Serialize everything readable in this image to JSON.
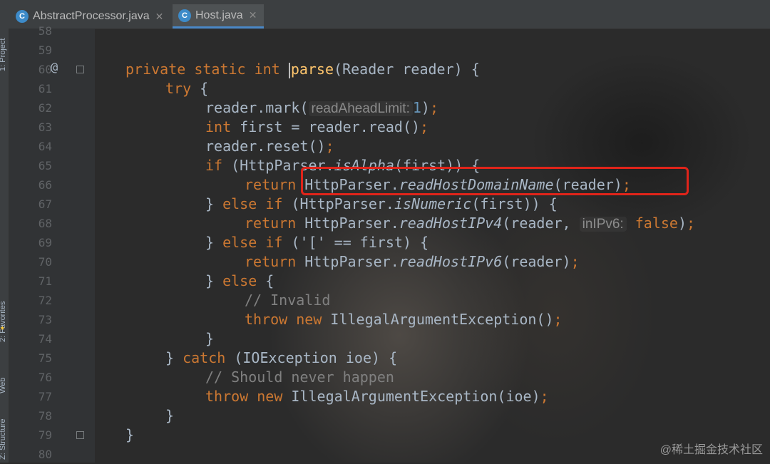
{
  "tabs": [
    {
      "label": "AbstractProcessor.java",
      "icon": "C",
      "active": false
    },
    {
      "label": "Host.java",
      "icon": "C",
      "active": true
    }
  ],
  "toolstrip": {
    "project_label": "1: Project",
    "favorites_label": "2: Favorites",
    "web_label": "Web",
    "structure_label": "Z: Structure"
  },
  "gutter": {
    "annotation_mark": "@",
    "line_numbers": [
      "58",
      "59",
      "60",
      "61",
      "62",
      "63",
      "64",
      "65",
      "66",
      "67",
      "68",
      "69",
      "70",
      "71",
      "72",
      "73",
      "74",
      "75",
      "76",
      "77",
      "78",
      "79",
      "80"
    ]
  },
  "code": {
    "l60_private": "private",
    "l60_static": "static",
    "l60_int": "int",
    "l60_parse": "parse",
    "l60_rest": "(Reader reader) {",
    "l61_try": "try",
    "l61_rest": " {",
    "l62_a": "reader.mark(",
    "l62_hint": "readAheadLimit:",
    "l62_num": "1",
    "l62_b": ")",
    "l62_semi": ";",
    "l63_int": "int",
    "l63_rest": " first = reader.read()",
    "l63_semi": ";",
    "l64_a": "reader.reset()",
    "l64_semi": ";",
    "l65_if": "if",
    "l65_a": " (HttpParser.",
    "l65_it": "isAlpha",
    "l65_b": "(first)) {",
    "l66_return": "return",
    "l66_a": " HttpParser.",
    "l66_it": "readHostDomainName",
    "l66_b": "(reader)",
    "l66_semi": ";",
    "l67_a": "} ",
    "l67_else": "else",
    "l67_if": "if",
    "l67_b": " (HttpParser.",
    "l67_it": "isNumeric",
    "l67_c": "(first)) {",
    "l68_return": "return",
    "l68_a": " HttpParser.",
    "l68_it": "readHostIPv4",
    "l68_b": "(reader, ",
    "l68_hint": "inIPv6:",
    "l68_false": "false",
    "l68_c": ")",
    "l68_semi": ";",
    "l69_a": "} ",
    "l69_else": "else",
    "l69_if": "if",
    "l69_b": " ('[' == first) {",
    "l70_return": "return",
    "l70_a": " HttpParser.",
    "l70_it": "readHostIPv6",
    "l70_b": "(reader)",
    "l70_semi": ";",
    "l71_a": "} ",
    "l71_else": "else",
    "l71_b": " {",
    "l72_cm": "// Invalid",
    "l73_throw": "throw",
    "l73_new": "new",
    "l73_a": " IllegalArgumentException()",
    "l73_semi": ";",
    "l74_a": "}",
    "l75_a": "} ",
    "l75_catch": "catch",
    "l75_b": " (IOException ioe) {",
    "l76_cm": "// Should never happen",
    "l77_throw": "throw",
    "l77_new": "new",
    "l77_a": " IllegalArgumentException(ioe)",
    "l77_semi": ";",
    "l78_a": "}",
    "l79_a": "}"
  },
  "watermark": "@稀土掘金技术社区",
  "colors": {
    "keyword": "#cc7832",
    "method_decl": "#ffc66d",
    "number": "#6897bb",
    "comment": "#808080",
    "highlight_box": "#e0241a"
  }
}
